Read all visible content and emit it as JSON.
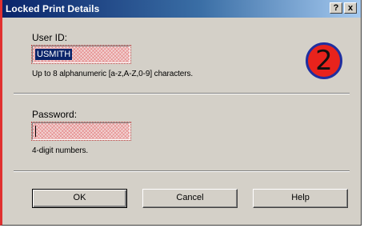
{
  "window": {
    "title": "Locked Print Details",
    "help_button": "?",
    "close_button": "x"
  },
  "user_id": {
    "label": "User ID:",
    "value": "USMITH",
    "hint": "Up to 8 alphanumeric [a-z,A-Z,0-9] characters."
  },
  "password": {
    "label": "Password:",
    "value": "",
    "hint": "4-digit numbers."
  },
  "badge": {
    "text": "2",
    "color": "#e8231c",
    "border_color": "#1f2fa0"
  },
  "buttons": {
    "ok": "OK",
    "cancel": "Cancel",
    "help": "Help"
  },
  "colors": {
    "title_bar_start": "#0a246a",
    "dialog_background": "#d4d0c8",
    "field_highlight": "#d63a3a"
  }
}
